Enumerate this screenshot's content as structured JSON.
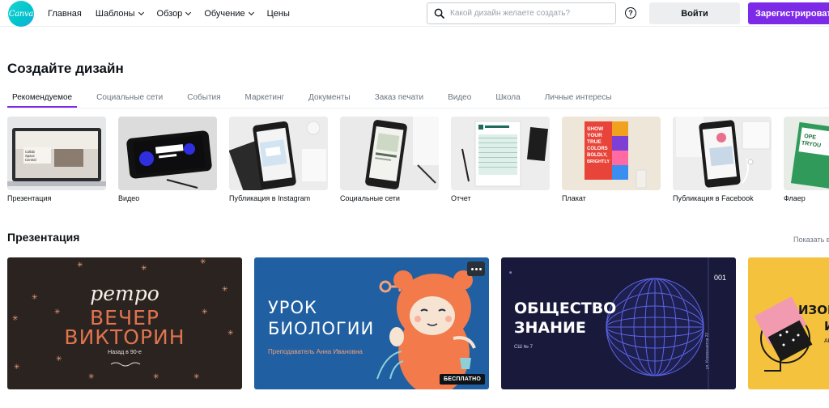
{
  "header": {
    "logo_text": "Canva",
    "nav": [
      {
        "label": "Главная",
        "dropdown": false
      },
      {
        "label": "Шаблоны",
        "dropdown": true
      },
      {
        "label": "Обзор",
        "dropdown": true
      },
      {
        "label": "Обучение",
        "dropdown": true
      },
      {
        "label": "Цены",
        "dropdown": false
      }
    ],
    "search_placeholder": "Какой дизайн желаете создать?",
    "help_label": "?",
    "login_label": "Войти",
    "signup_label": "Зарегистрироваться",
    "accent_color": "#7d2ae8"
  },
  "create": {
    "title": "Создайте дизайн",
    "tabs": [
      "Рекомендуемое",
      "Социальные сети",
      "События",
      "Маркетинг",
      "Документы",
      "Заказ печати",
      "Видео",
      "Школа",
      "Личные интересы"
    ],
    "active_tab": 0,
    "designs": [
      {
        "label": "Презентация",
        "thumb_text": "Collab Space Central"
      },
      {
        "label": "Видео",
        "thumb_text": "CARDIE CHAOS"
      },
      {
        "label": "Публикация в Instagram",
        "thumb_text": ""
      },
      {
        "label": "Социальные сети",
        "thumb_text": ""
      },
      {
        "label": "Отчет",
        "thumb_text": ""
      },
      {
        "label": "Плакат",
        "thumb_text": "SHOW YOUR TRUE COLORS BOLDLY, BRIGHTLY"
      },
      {
        "label": "Публикация в Facebook",
        "thumb_text": ""
      },
      {
        "label": "Флаер",
        "thumb_text": "OPEN TRYOUT"
      }
    ]
  },
  "presentation": {
    "title": "Презентация",
    "show_all": "Показать все",
    "cards": [
      {
        "line1": "ретро",
        "line2": "ВЕЧЕР",
        "line3": "ВИКТОРИН",
        "subtitle": "Назад в 90-е",
        "badge": ""
      },
      {
        "line1": "УРОК",
        "line2": "БИОЛОГИИ",
        "subtitle": "Преподаватель Анна Ивановна",
        "badge": "БЕСПЛАТНО",
        "more": true
      },
      {
        "line1": "ОБЩЕСТВО",
        "line2": "ЗНАНИЕ",
        "subtitle": "СШ № 7",
        "number": "001",
        "vertical": "ул. Космонавтов 22"
      },
      {
        "line1": "ИЗОБ",
        "line2": "И",
        "subtitle": "АК"
      }
    ]
  }
}
